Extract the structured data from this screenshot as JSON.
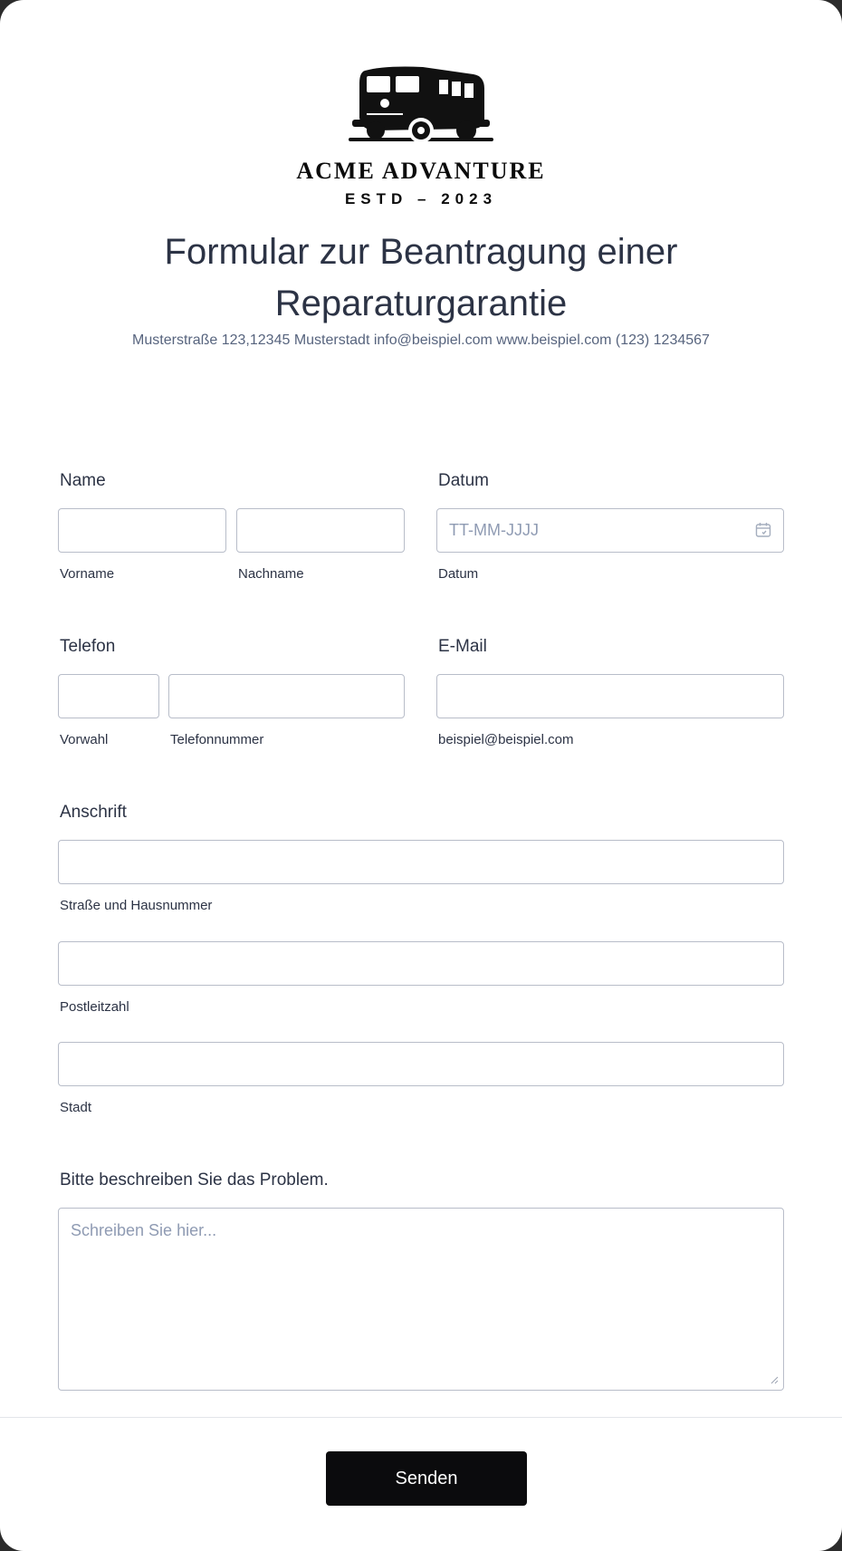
{
  "brand": {
    "name": "ACME ADVANTURE",
    "estd": "ESTD – 2023",
    "logo_icon": "camper-van-icon"
  },
  "form": {
    "title": "Formular zur Beantragung einer Reparaturgarantie",
    "subtitle": "Musterstraße 123,12345 Musterstadt info@beispiel.com www.beispiel.com (123) 1234567"
  },
  "fields": {
    "name": {
      "label": "Name",
      "first_sublabel": "Vorname",
      "last_sublabel": "Nachname",
      "first_value": "",
      "last_value": ""
    },
    "date": {
      "label": "Datum",
      "placeholder": "TT-MM-JJJJ",
      "sublabel": "Datum",
      "icon": "calendar-icon"
    },
    "phone": {
      "label": "Telefon",
      "area_sublabel": "Vorwahl",
      "number_sublabel": "Telefonnummer"
    },
    "email": {
      "label": "E-Mail",
      "sublabel": "beispiel@beispiel.com"
    },
    "address": {
      "label": "Anschrift",
      "street_sublabel": "Straße und Hausnummer",
      "zip_sublabel": "Postleitzahl",
      "city_sublabel": "Stadt"
    },
    "problem": {
      "label": "Bitte beschreiben Sie das Problem.",
      "placeholder": "Schreiben Sie hier..."
    }
  },
  "submit": {
    "label": "Senden"
  },
  "colors": {
    "text": "#2c3345",
    "muted": "#57647e",
    "border": "#b8bdc9",
    "button": "#0b0b0d"
  }
}
